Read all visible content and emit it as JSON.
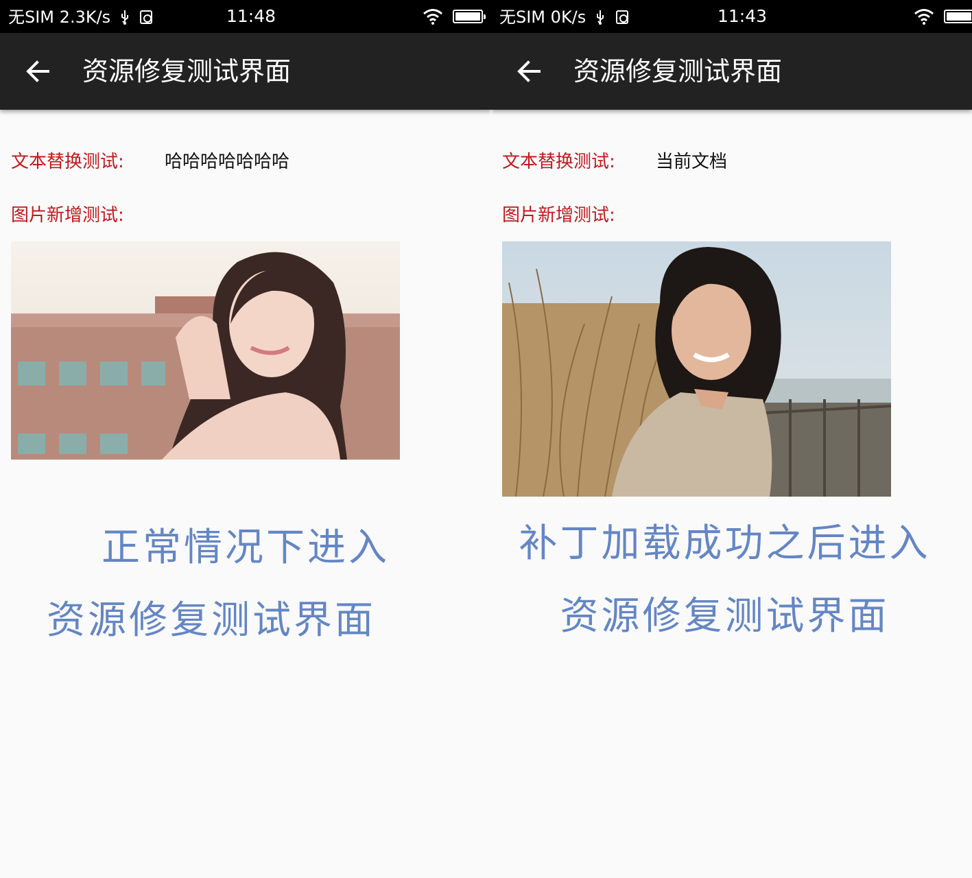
{
  "screens": [
    {
      "status": {
        "carrier": "无SIM",
        "speed": "2.3K/s",
        "time": "11:48"
      },
      "toolbar": {
        "title": "资源修复测试界面"
      },
      "text_test": {
        "label": "文本替换测试:",
        "value": "哈哈哈哈哈哈哈"
      },
      "image_test": {
        "label": "图片新增测试:"
      },
      "caption": {
        "line1": "正常情况下进入",
        "line2": "资源修复测试界面"
      }
    },
    {
      "status": {
        "carrier": "无SIM",
        "speed": "0K/s",
        "time": "11:43"
      },
      "toolbar": {
        "title": "资源修复测试界面"
      },
      "text_test": {
        "label": "文本替换测试:",
        "value": "当前文档"
      },
      "image_test": {
        "label": "图片新增测试:"
      },
      "caption": {
        "line1": "补丁加载成功之后进入",
        "line2": "资源修复测试界面"
      }
    }
  ],
  "colors": {
    "label_red": "#c0191c",
    "caption_blue": "#6486c4",
    "toolbar": "#222222",
    "statusbar": "#000000"
  },
  "icons": [
    "usb-icon",
    "debug-icon",
    "wifi-icon",
    "battery-icon",
    "back-arrow-icon"
  ]
}
